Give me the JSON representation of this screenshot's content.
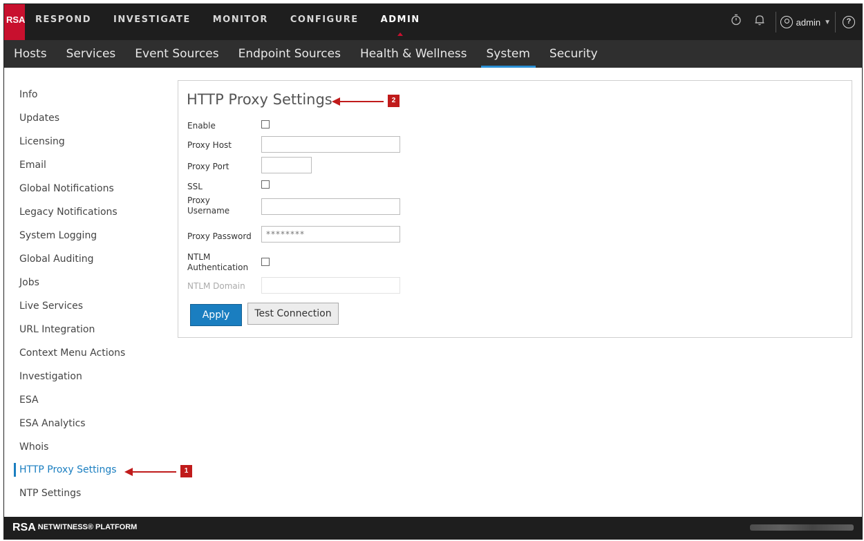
{
  "header": {
    "logo": "RSA",
    "nav": [
      {
        "label": "RESPOND",
        "active": false
      },
      {
        "label": "INVESTIGATE",
        "active": false
      },
      {
        "label": "MONITOR",
        "active": false
      },
      {
        "label": "CONFIGURE",
        "active": false
      },
      {
        "label": "ADMIN",
        "active": true
      }
    ],
    "icons": [
      "stopwatch-icon",
      "bell-icon",
      "user-icon",
      "help-icon"
    ],
    "user": "admin",
    "help_glyph": "?"
  },
  "subnav": [
    {
      "label": "Hosts",
      "active": false
    },
    {
      "label": "Services",
      "active": false
    },
    {
      "label": "Event Sources",
      "active": false
    },
    {
      "label": "Endpoint Sources",
      "active": false
    },
    {
      "label": "Health & Wellness",
      "active": false
    },
    {
      "label": "System",
      "active": true
    },
    {
      "label": "Security",
      "active": false
    }
  ],
  "sidebar": {
    "items": [
      "Info",
      "Updates",
      "Licensing",
      "Email",
      "Global Notifications",
      "Legacy Notifications",
      "System Logging",
      "Global Auditing",
      "Jobs",
      "Live Services",
      "URL Integration",
      "Context Menu Actions",
      "Investigation",
      "ESA",
      "ESA Analytics",
      "Whois",
      "HTTP Proxy Settings",
      "NTP Settings"
    ],
    "active_item": "HTTP Proxy Settings"
  },
  "panel": {
    "title": "HTTP Proxy Settings",
    "fields": {
      "enable_label": "Enable",
      "enable_checked": false,
      "proxy_host_label": "Proxy Host",
      "proxy_host_value": "",
      "proxy_port_label": "Proxy Port",
      "proxy_port_value": "",
      "ssl_label": "SSL",
      "ssl_checked": false,
      "proxy_username_label_1": "Proxy",
      "proxy_username_label_2": "Username",
      "proxy_username_value": "",
      "proxy_password_label": "Proxy Password",
      "proxy_password_value": "********",
      "ntlm_auth_label_1": "NTLM",
      "ntlm_auth_label_2": "Authentication",
      "ntlm_auth_checked": false,
      "ntlm_domain_label": "NTLM Domain",
      "ntlm_domain_value": ""
    },
    "apply_label": "Apply",
    "test_label": "Test Connection"
  },
  "callouts": {
    "one": "1",
    "two": "2",
    "color": "#c01b1b"
  },
  "footer": {
    "logo": "RSA",
    "logo_sub": "NETWITNESS® PLATFORM"
  },
  "colors": {
    "accent": "#1a7ec0",
    "brand": "#c8102e",
    "header_bg": "#1e1e1e",
    "subnav_bg": "#2f2f2f"
  }
}
